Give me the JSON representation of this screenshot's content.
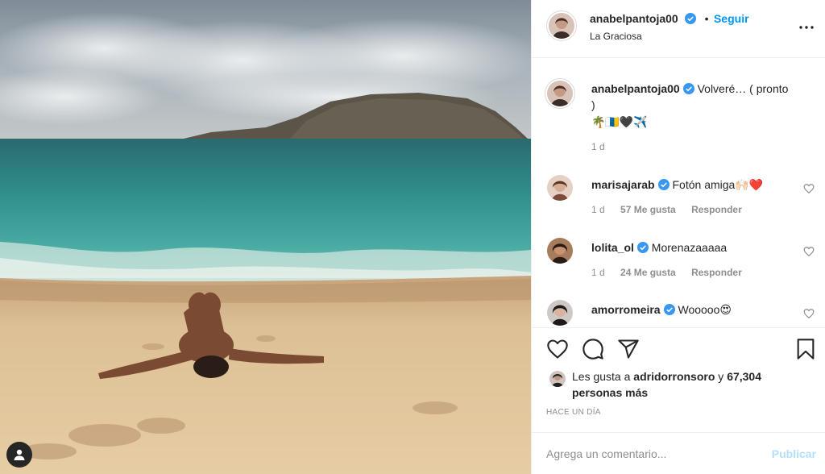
{
  "post": {
    "author": {
      "username": "anabelpantoja00",
      "verified": true,
      "follow_label": "Seguir",
      "location": "La Graciosa"
    },
    "caption": {
      "username": "anabelpantoja00",
      "text": "Volveré… ( pronto )",
      "emoji_line": "🌴🇮🇨🖤✈️",
      "age": "1 d"
    },
    "comments": [
      {
        "username": "marisajarab",
        "verified": true,
        "text": "Fotón amiga🙌🏻❤️",
        "age": "1 d",
        "likes": "57 Me gusta",
        "reply_label": "Responder"
      },
      {
        "username": "lolita_ol",
        "verified": true,
        "text": "Morenazaaaaa",
        "age": "1 d",
        "likes": "24 Me gusta",
        "reply_label": "Responder"
      },
      {
        "username": "amorromeira",
        "verified": true,
        "text": "Wooooo😍"
      }
    ],
    "likes": {
      "prefix": "Les gusta a",
      "liker": "adridorronsoro",
      "connector": "y",
      "others": "67,304 personas más"
    },
    "timestamp": "Hace un día",
    "add_comment": {
      "placeholder": "Agrega un comentario...",
      "publish_label": "Publicar"
    }
  },
  "icons": {
    "more": "more-options-icon",
    "like": "heart-icon",
    "comment": "comment-icon",
    "share": "share-icon",
    "save": "bookmark-icon",
    "verified": "verified-badge-icon",
    "tagged_user": "user-tag-icon"
  },
  "colors": {
    "link_blue": "#0095f6",
    "publish_disabled": "#b2dffc",
    "muted_text": "#8e8e8e",
    "verified_blue": "#3897f0"
  }
}
